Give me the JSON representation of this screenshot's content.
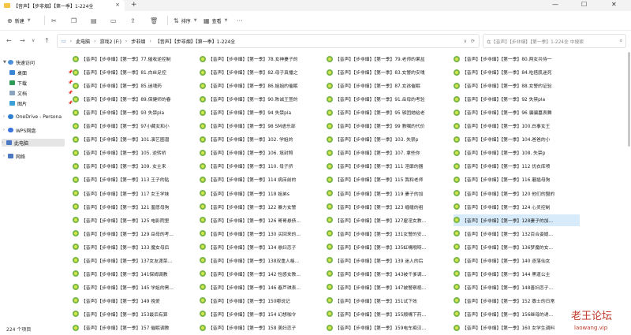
{
  "window": {
    "tab_title": "【音声】【步非烟】【第一季】1-224全"
  },
  "toolbar": {
    "new_label": "新建",
    "sort_label": "排序",
    "view_label": "查看"
  },
  "address": {
    "crumbs": [
      "此电脑",
      "游戏2 (F:)",
      "步非烟",
      "【音声】【步非烟】【第一季】1-224全"
    ],
    "search_placeholder": "在【音声】【步非烟】【第一季】1-224全 中搜索"
  },
  "sidebar": {
    "items": [
      {
        "label": "快速访问"
      },
      {
        "label": "桌面"
      },
      {
        "label": "下载"
      },
      {
        "label": "文档"
      },
      {
        "label": "图片"
      },
      {
        "label": "OneDrive - Persona"
      },
      {
        "label": "WPS网盘"
      },
      {
        "label": "此电脑"
      },
      {
        "label": "网络"
      }
    ]
  },
  "files": [
    "【音声】【步非烟】【第一季】77.催收逆控制",
    "【音声】【步非烟】【第一季】78.女神妻子的",
    "【音声】【步非烟】【第一季】79.老师的果盆",
    "【音声】【步非烟】【第一季】80.两女共侍一",
    "【音声】【步非烟】【第一季】81.白丝足控",
    "【音声】【步非烟】【第一季】82.母子真播之",
    "【音声】【步非烟】【第一季】83.女警的安魂",
    "【音声】【步非烟】【第一季】84.吃搭肌迷死",
    "【音声】【步非烟】【第一季】85.迷魂药",
    "【音声】【步非烟】【第一季】86.姐姐的催眠",
    "【音声】【步非烟】【第一季】87.女孩催眠",
    "【音声】【步非烟】【第一季】88.女警的证验",
    "【音声】【步非烟】【第一季】89.保健师的春",
    "【音声】【步非烟】【第一季】90.陈诚王萱的",
    "【音声】【步非烟】【第一季】91.岳母的考验",
    "【音声】【步非烟】【第一季】92 失禁pla",
    "【音声】【步非烟】【第一季】93 失禁pla",
    "【音声】【步非烟】【第一季】94 失禁pla",
    "【音声】【步非烟】【第一季】95 够团她给老",
    "【音声】【步非烟】【第一季】96 骗骗墓表舞",
    "【音声】【步非烟】【第一季】97小藏女和小",
    "【音声】【步非烟】【第一季】98 SM虐乐部",
    "【音声】【步非烟】【第一季】99 教嘱的代价",
    "【音声】【步非烟】【第一季】100.白事女王",
    "【音声】【步非烟】【第一季】101.演艺圈潜",
    "【音声】【步非烟】【第一季】102. 学姐的",
    "【音声】【步非烟】【第一季】103. 失禁p",
    "【音声】【步非烟】【第一季】104.爸爸的小",
    "【音声】【步非烟】【第一季】105. 逆转桥",
    "【音声】【步非烟】【第一季】106. 填封照",
    "【音声】【步非烟】【第一季】107. 拿些你",
    "【音声】【步非烟】【第一季】108. 失禁p",
    "【音声】【步非烟】【第一季】109. 女主来",
    "【音声】【步非烟】【第一季】110. 母子挤",
    "【音声】【步非烟】【第一季】111 淫靡的器",
    "【音声】【步非烟】【第一季】112 优衣库喷",
    "【音声】【步非烟】【第一季】113 王子的贴",
    "【音声】【步非烟】【第一季】114 病床前的",
    "【音声】【步非烟】【第一季】115 我和老师",
    "【音声】【步非烟】【第一季】116 蘑插母狗",
    "【音声】【步非烟】【第一季】117 女王学妹",
    "【音声】【步非烟】【第一季】118 姐弟s",
    "【音声】【步非烟】【第一季】119 妻子的加",
    "【音声】【步非烟】【第一季】120 他们的盟的",
    "【音声】【步非烟】【第一季】121 羞愿母狗",
    "【音声】【步非烟】【第一季】122 暴力女警",
    "【音声】【步非烟】【第一季】123 缠缠的祖",
    "【音声】【步非烟】【第一季】124 心灵控制",
    "【音声】【步非烟】【第一季】125 电影院里",
    "【音声】【步非烟】【第一季】126 哥哥悬债...",
    "【音声】【步非烟】【第一季】127雇淫女教...",
    "【音声】【步非烟】【第一季】128妻子的加...",
    "【音声】【步非烟】【第一季】129 岳母的考...",
    "【音声】【步非烟】【第一季】130 买回来的...",
    "【音声】【步非烟】【第一季】131女警的安...",
    "【音声】【步非烟】【第一季】132百合姿媳...",
    "【音声】【步非烟】【第一季】133 魔女母后",
    "【音声】【步非烟】【第一季】134 悬妇恋子",
    "【音声】【步非烟】【第一季】135虹嘴哦呀...",
    "【音声】【步非烟】【第一季】136梦魔的女...",
    "【音声】【步非烟】【第一季】137女友渡菜...",
    "【音声】【步非烟】【第一季】138双重人格...",
    "【音声】【步非烟】【第一季】139 迷人的后",
    "【音声】【步非烟】【第一季】140 逐落仙女",
    "【音声】【步非烟】【第一季】141保姆调教",
    "【音声】【步非烟】【第一季】142 性感女教...",
    "【音声】【步非烟】【第一季】143被千爹调...",
    "【音声】【步非烟】【第一季】144 黑道公主",
    "【音声】【步非烟】【第一季】145 学姐的黑...",
    "【音声】【步非烟】【第一季】146 春芦琪表...",
    "【音声】【步非烟】【第一季】147被警察视...",
    "【音声】【步非烟】【第一季】148善妇恋子...",
    "【音声】【步非烟】【第一季】149 挽爱",
    "【音声】【步非烟】【第一季】150哪说记",
    "【音声】【步非烟】【第一季】151试下效",
    "【音声】【步非烟】【第一季】152 寡士的日常",
    "【音声】【步非烟】【第一季】153最后有算",
    "【音声】【步非烟】【第一季】154 幻想咖令",
    "【音声】【步非烟】【第一季】155顺嘴下药...",
    "【音声】【步非烟】【第一季】156继母的诱...",
    "【音声】【步非烟】【第一季】157 催眠调教",
    "【音声】【步非烟】【第一季】158 美妇恋子",
    "【音声】【步非烟】【第一季】159电车痴汉...",
    "【音声】【步非烟】【第一季】160 女学生调料"
  ],
  "status": {
    "count": "224 个项目"
  },
  "watermark": {
    "title": "老王论坛",
    "url": "laowang.vip"
  }
}
